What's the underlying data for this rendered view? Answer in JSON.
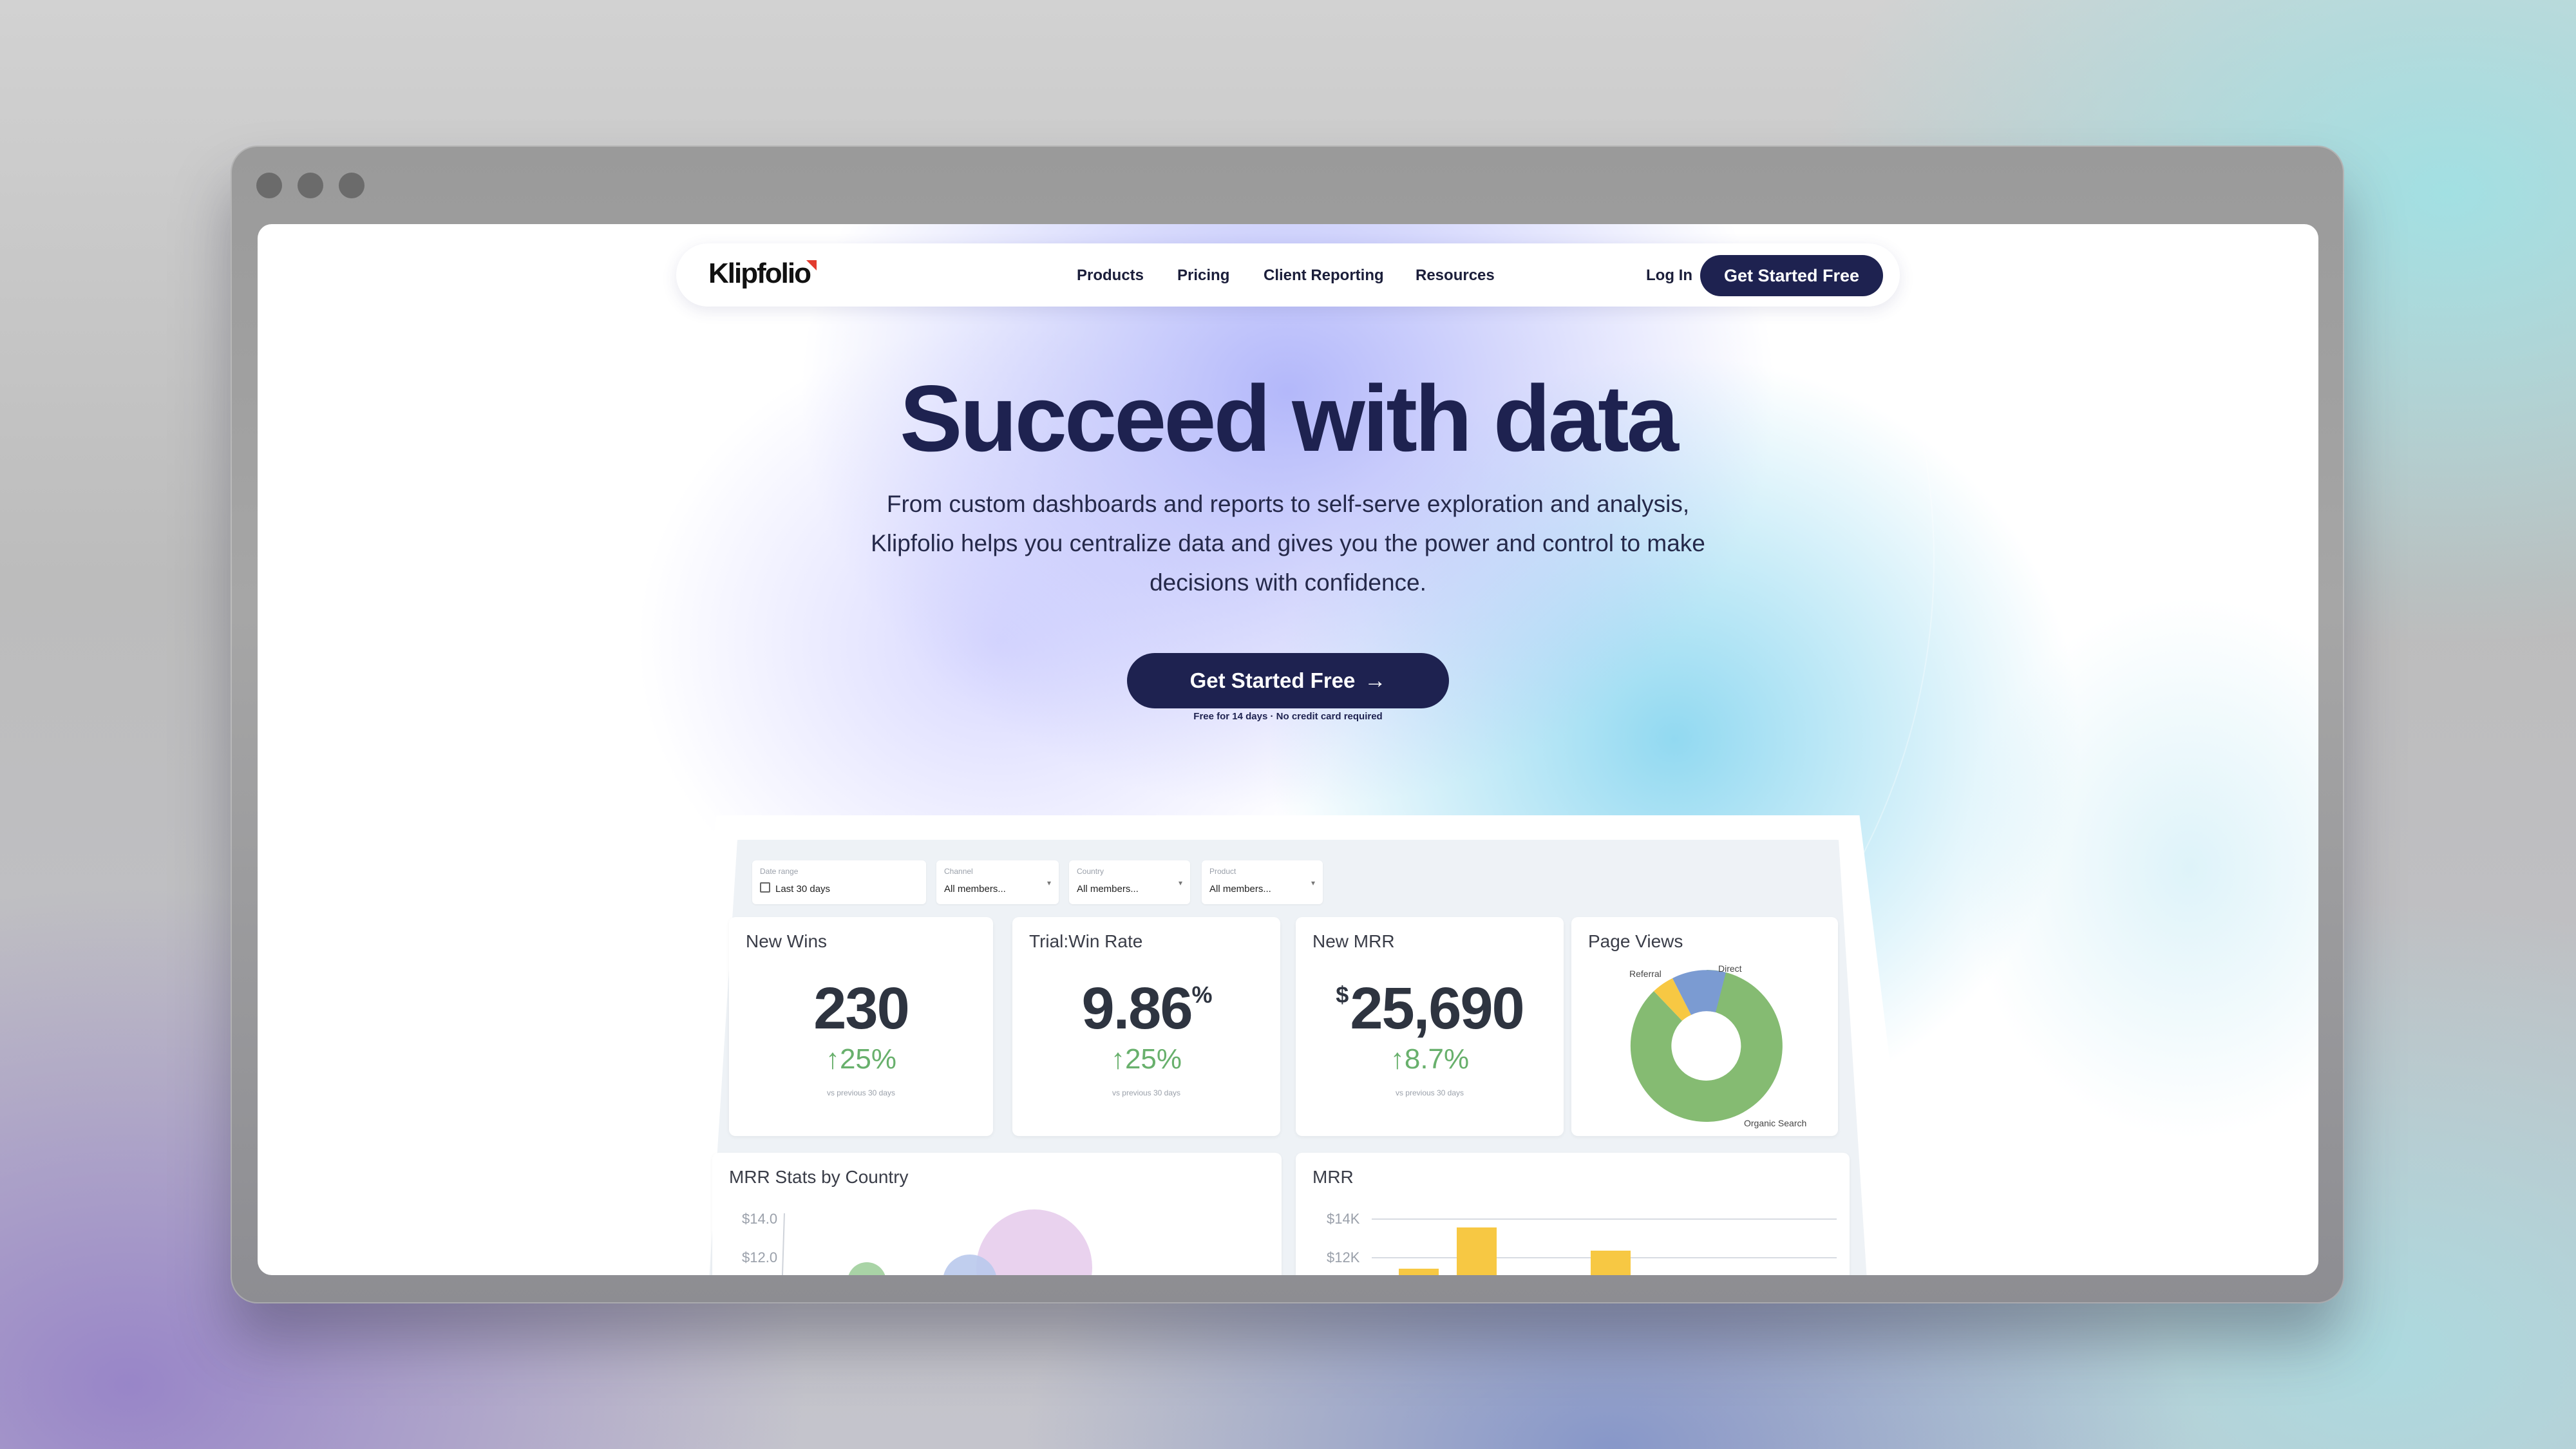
{
  "nav": {
    "brand": "Klipfolio",
    "links": [
      "Products",
      "Pricing",
      "Client Reporting",
      "Resources"
    ],
    "login": "Log In",
    "cta": "Get Started Free"
  },
  "hero": {
    "title": "Succeed with data",
    "subtitle_lines": [
      "From custom dashboards and reports to self-serve exploration and analysis,",
      "Klipfolio helps you centralize data and gives you the power and control to make",
      "decisions with confidence."
    ],
    "cta": "Get Started Free",
    "cta_arrow": "→",
    "note": "Free for 14 days · No credit card required"
  },
  "dashboard": {
    "filters": [
      {
        "label": "Date range",
        "value": "Last 30 days"
      },
      {
        "label": "Channel",
        "value": "All members..."
      },
      {
        "label": "Country",
        "value": "All members..."
      },
      {
        "label": "Product",
        "value": "All members..."
      }
    ],
    "cards": [
      {
        "title": "New Wins",
        "value": "230",
        "delta": "↑25%",
        "note": "vs previous 30 days"
      },
      {
        "title": "Trial:Win Rate",
        "value": "9.86",
        "suffix": "%",
        "delta": "↑25%",
        "note": "vs previous 30 days"
      },
      {
        "title": "New MRR",
        "prefix": "$",
        "value": "25,690",
        "delta": "↑8.7%",
        "note": "vs previous 30 days"
      }
    ],
    "page_views": {
      "title": "Page Views",
      "labels": {
        "referral": "Referral",
        "direct": "Direct",
        "organic": "Organic Search"
      }
    },
    "mrr_country": {
      "title": "MRR Stats by Country",
      "y_ticks": [
        "$14.0",
        "$12.0"
      ]
    },
    "mrr": {
      "title": "MRR",
      "y_ticks": [
        "$14K",
        "$12K"
      ]
    },
    "colors": {
      "navy": "#1e2250",
      "green": "#68b06c",
      "donut_green": "#85bb72",
      "donut_blue": "#7b9bd2",
      "donut_yellow": "#f7c843",
      "bar_yellow": "#f7c843"
    }
  }
}
